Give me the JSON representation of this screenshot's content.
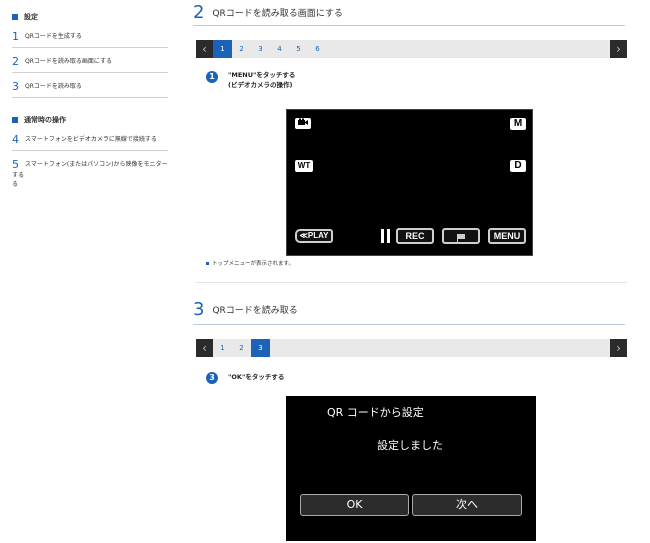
{
  "sidebar": {
    "section1": "設定",
    "items1": [
      {
        "num": "1",
        "label": "QRコードを生成する"
      },
      {
        "num": "2",
        "label": "QRコードを読み取る画面にする"
      },
      {
        "num": "3",
        "label": "QRコードを読み取る"
      }
    ],
    "section2": "通常時の操作",
    "items2": [
      {
        "num": "4",
        "label": "スマートフォンをビデオカメラに無線で接続する"
      },
      {
        "num": "5",
        "label": "スマートフォン(またはパソコン)から映像をモニターする",
        "label_wrap": "る"
      }
    ]
  },
  "step2": {
    "num": "2",
    "title": "QRコードを読み取る画面にする",
    "pages": [
      "1",
      "2",
      "3",
      "4",
      "5",
      "6"
    ],
    "active_page": "1",
    "prev": "‹",
    "next": "›",
    "instruction_num": "1",
    "instruction_line1": "\"MENU\"をタッチする",
    "instruction_line2": "(ビデオカメラの操作)",
    "screen": {
      "m": "M",
      "wt": "WT",
      "d": "D",
      "play": "≪PLAY",
      "rec": "REC",
      "menu": "MENU"
    },
    "note": "トップメニューが表示されます。"
  },
  "step3": {
    "num": "3",
    "title": "QRコードを読み取る",
    "pages": [
      "1",
      "2",
      "3"
    ],
    "active_page": "3",
    "prev": "‹",
    "next": "›",
    "instruction_num": "3",
    "instruction": "\"OK\"をタッチする",
    "dialog": {
      "title": "QR コードから設定",
      "message": "設定しました",
      "ok": "OK",
      "next": "次へ"
    }
  }
}
